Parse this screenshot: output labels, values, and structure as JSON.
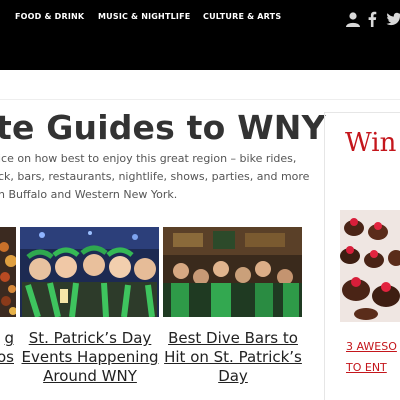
{
  "nav": {
    "items": [
      {
        "label": "FOOD & DRINK"
      },
      {
        "label": "MUSIC & NIGHTLIFE"
      },
      {
        "label": "CULTURE & ARTS"
      }
    ],
    "icons": [
      "user-icon",
      "facebook-icon",
      "twitter-icon"
    ]
  },
  "hero": {
    "title": "te Guides to WNY",
    "intro_lines": [
      "ice on how best to enjoy this great region – bike rides,",
      "ck, bars, restaurants, nightlife, shows, parties, and more",
      "n Buffalo and Western New York."
    ]
  },
  "cards": [
    {
      "title_lines": [
        "g",
        "os"
      ]
    },
    {
      "title_lines": [
        "St. Patrick’s Day",
        "Events Happening",
        "Around WNY"
      ]
    },
    {
      "title_lines": [
        "Best Dive Bars to",
        "Hit on St. Patrick’s",
        "Day"
      ]
    }
  ],
  "sidebar": {
    "title": "Win I",
    "link_lines": [
      "3 AWESO",
      "TO ENT"
    ]
  },
  "colors": {
    "topbar": "#000000",
    "accent": "#c4161c",
    "text": "#333333"
  }
}
